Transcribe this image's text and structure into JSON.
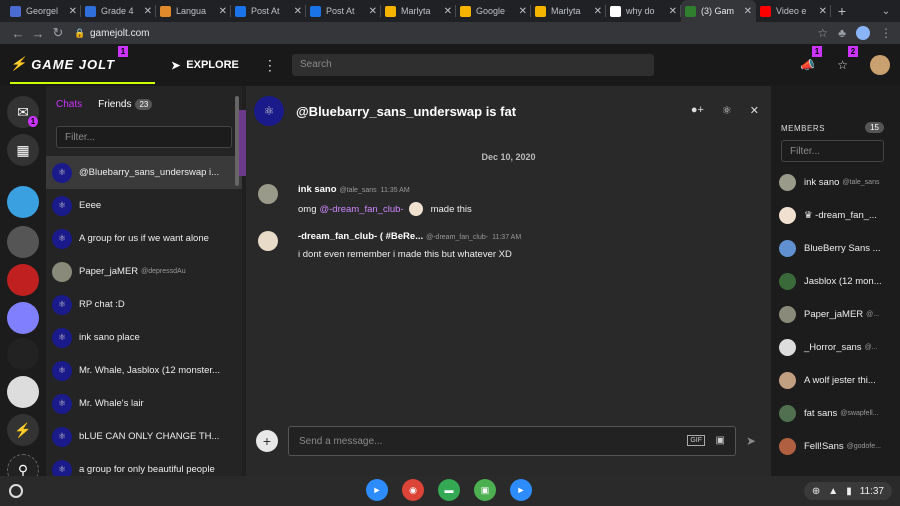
{
  "browser": {
    "tabs": [
      {
        "title": "Georgel",
        "color": "#4a6bd0"
      },
      {
        "title": "Grade 4",
        "color": "#2e6fdc"
      },
      {
        "title": "Langua",
        "color": "#e08a2c"
      },
      {
        "title": "Post At",
        "color": "#1a73e8"
      },
      {
        "title": "Post At",
        "color": "#1a73e8"
      },
      {
        "title": "Marlyta",
        "color": "#f4b400"
      },
      {
        "title": "Google",
        "color": "#f4b400"
      },
      {
        "title": "Marlyta",
        "color": "#f4b400"
      },
      {
        "title": "why do",
        "color": "#ffffff"
      },
      {
        "title": "(3) Gam",
        "color": "#2f7f2f"
      },
      {
        "title": "Video e",
        "color": "#ff0000"
      }
    ],
    "url": "gamejolt.com"
  },
  "header": {
    "logo": "GAME JOLT",
    "logo_badge": "1",
    "explore": "EXPLORE",
    "search_placeholder": "Search",
    "notif_badge": "1",
    "friends_badge": "2"
  },
  "rail": {
    "badge": "1"
  },
  "chatlist": {
    "tab_chats": "Chats",
    "tab_friends": "Friends",
    "friends_count": "23",
    "filter_placeholder": "Filter...",
    "items": [
      {
        "name": "@Bluebarry_sans_underswap i...",
        "sub": "",
        "group": true
      },
      {
        "name": "Eeee",
        "sub": "",
        "group": true
      },
      {
        "name": "A group for us if we want alone",
        "sub": "",
        "group": true
      },
      {
        "name": "Paper_jaMER",
        "sub": "@depressdAu",
        "group": false
      },
      {
        "name": "RP chat :D",
        "sub": "",
        "group": true
      },
      {
        "name": "ink sano place",
        "sub": "",
        "group": true
      },
      {
        "name": "Mr. Whale, Jasblox (12 monster...",
        "sub": "",
        "group": true
      },
      {
        "name": "Mr. Whale's lair",
        "sub": "",
        "group": true
      },
      {
        "name": "bLUE CAN ONLY CHANGE TH...",
        "sub": "",
        "group": true
      },
      {
        "name": "a group for only beautiful people",
        "sub": "",
        "group": true
      }
    ]
  },
  "chat": {
    "title": "@Bluebarry_sans_underswap is fat",
    "date": "Dec 10, 2020",
    "messages": [
      {
        "name": "ink sano",
        "handle": "@tale_sans",
        "time": "11:35 AM",
        "pre": "omg",
        "mention": "@-dream_fan_club-",
        "post": "made this"
      },
      {
        "name": "-dream_fan_club- ( #BeRe...",
        "handle": "@-dream_fan_club-",
        "time": "11:37 AM",
        "text": "i dont even remember i made this but whatever XD"
      }
    ],
    "composer_placeholder": "Send a message...",
    "gif_label": "GIF"
  },
  "members": {
    "heading": "MEMBERS",
    "count": "15",
    "filter_placeholder": "Filter...",
    "items": [
      {
        "name": "ink sano",
        "sub": "@tale_sans"
      },
      {
        "name": "♛ -dream_fan_...",
        "sub": ""
      },
      {
        "name": "BlueBerry Sans ...",
        "sub": ""
      },
      {
        "name": "Jasblox (12 mon...",
        "sub": ""
      },
      {
        "name": "Paper_jaMER",
        "sub": "@..."
      },
      {
        "name": "_Horror_sans",
        "sub": "@..."
      },
      {
        "name": "A wolf jester thi...",
        "sub": ""
      },
      {
        "name": "fat sans",
        "sub": "@swapfell..."
      },
      {
        "name": "Fell!Sans",
        "sub": "@godofe..."
      }
    ]
  },
  "shelf": {
    "time": "11:37"
  }
}
